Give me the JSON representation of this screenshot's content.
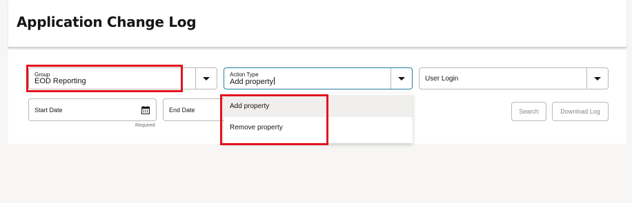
{
  "page": {
    "title": "Application Change Log"
  },
  "filters": {
    "group": {
      "label": "Group",
      "value": "EOD Reporting"
    },
    "action_type": {
      "label": "Action Type",
      "value": "Add property"
    },
    "user_login": {
      "label": "User Login"
    },
    "start_date": {
      "label": "Start Date",
      "hint": "Required"
    },
    "end_date": {
      "label": "End Date"
    }
  },
  "buttons": {
    "search": "Search",
    "download_log": "Download Log"
  },
  "action_type_menu": {
    "options": [
      "Add property",
      "Remove property"
    ],
    "selected": "Add property"
  },
  "icons": {
    "dropdown": "chevron-down-icon",
    "calendar": "calendar-icon"
  },
  "colors": {
    "focus_border": "#227e9e",
    "annotation_red": "#e2121c",
    "active_option_bg": "#f1efed"
  }
}
